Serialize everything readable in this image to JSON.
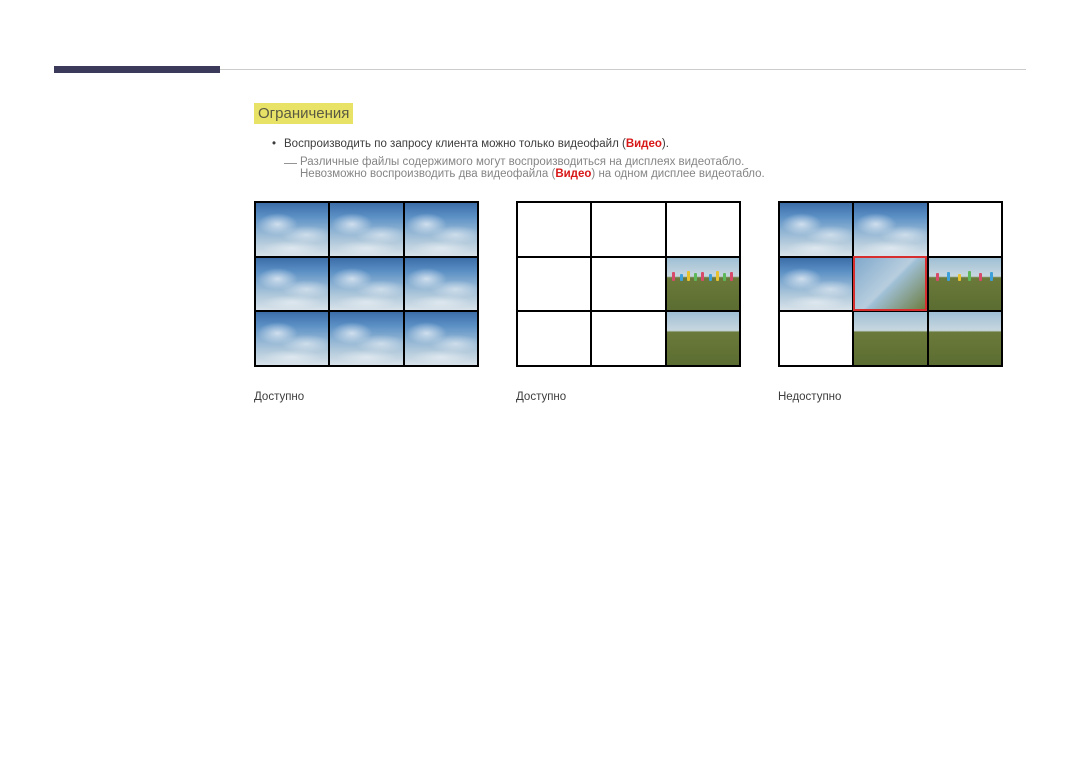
{
  "section": {
    "heading": "Ограничения",
    "bullet": {
      "prefix": "Воспроизводить по запросу клиента можно только видеофайл (",
      "video_word": "Видео",
      "suffix": ")."
    },
    "sub": {
      "line1": "Различные файлы содержимого могут воспроизводиться на дисплеях видеотабло.",
      "line2_prefix": "Невозможно воспроизводить два видеофайла (",
      "line2_video": "Видео",
      "line2_suffix": ") на одном дисплее видеотабло."
    }
  },
  "figures": [
    {
      "caption": "Доступно"
    },
    {
      "caption": "Доступно"
    },
    {
      "caption": "Недоступно"
    }
  ],
  "colors": {
    "highlight_bg": "#e8e267",
    "red": "#d81818",
    "bar": "#3b3a5b"
  }
}
